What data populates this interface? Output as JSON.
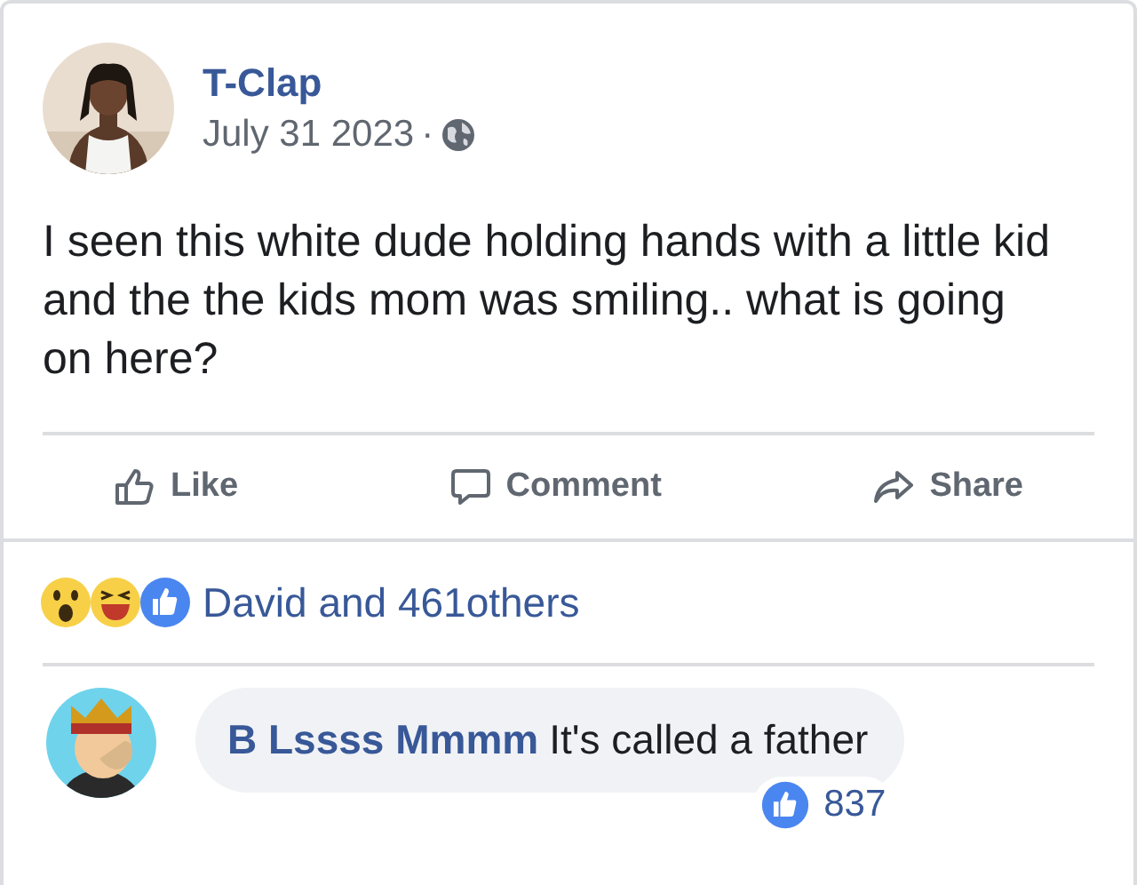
{
  "post": {
    "author": "T-Clap",
    "date": "July 31 2023",
    "separator": "·",
    "text": "I seen this white dude holding hands with a little kid and the the kids mom was smiling.. what is going on here?"
  },
  "actions": [
    {
      "kind": "like",
      "label": "Like"
    },
    {
      "kind": "comment",
      "label": "Comment"
    },
    {
      "kind": "share",
      "label": "Share"
    }
  ],
  "reactions": {
    "icons": [
      {
        "kind": "wow"
      },
      {
        "kind": "haha"
      },
      {
        "kind": "like"
      }
    ],
    "summary": "David and 461others"
  },
  "comment": {
    "author": "B Lssss Mmmm",
    "text": "It's called a father",
    "likes": "837"
  }
}
